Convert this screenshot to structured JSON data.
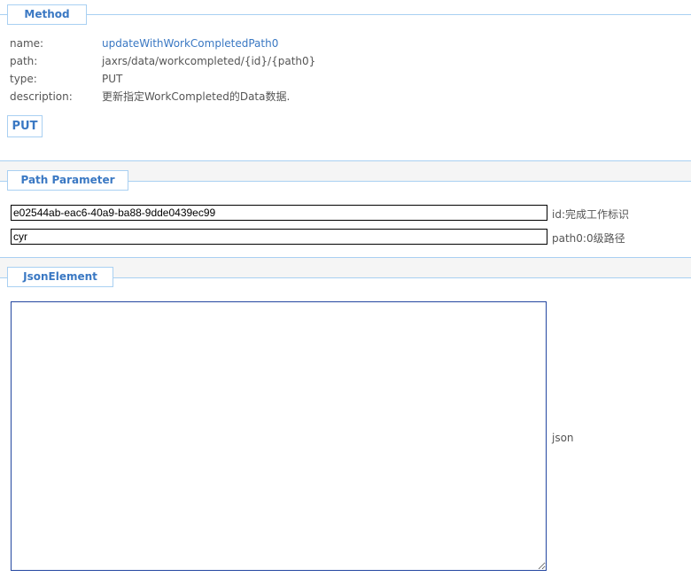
{
  "method_section": {
    "title": "Method",
    "fields": [
      {
        "key": "name:",
        "value": "updateWithWorkCompletedPath0"
      },
      {
        "key": "path:",
        "value": "jaxrs/data/workcompleted/{id}/{path0}"
      },
      {
        "key": "type:",
        "value": "PUT"
      },
      {
        "key": "description:",
        "value": "更新指定WorkCompleted的Data数据."
      }
    ],
    "submit_label": "PUT"
  },
  "path_section": {
    "title": "Path Parameter",
    "params": [
      {
        "value": "e02544ab-eac6-40a9-ba88-9dde0439ec99",
        "label": "id:完成工作标识"
      },
      {
        "value": "cyr",
        "label": "path0:0级路径"
      }
    ]
  },
  "json_section": {
    "title": "JsonElement",
    "value": "",
    "label": "json"
  },
  "colors": {
    "accent": "#3a78c3",
    "border": "#a9d0f2",
    "textarea_border": "#2346a0"
  }
}
